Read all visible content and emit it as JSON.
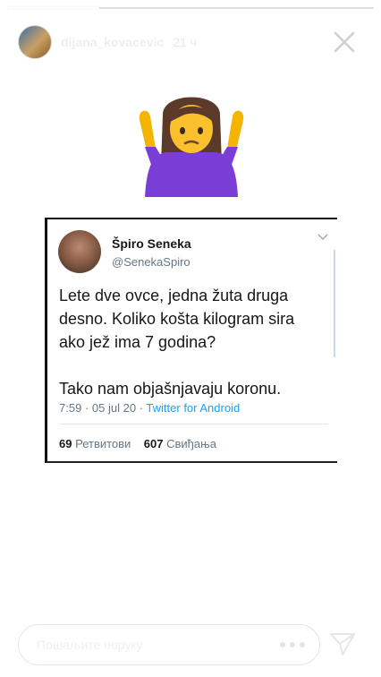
{
  "story": {
    "username": "dijana_kovacevic",
    "time": "21 ч",
    "progress": 0.25
  },
  "tweet": {
    "name": "Špiro Seneka",
    "handle": "@SenekaSpiro",
    "text": "Lete dve ovce, jedna žuta druga\ndesno. Koliko košta kilogram sira\nako jež ima 7 godina?\n\nTako nam objašnjavaju koronu.",
    "time": "7:59",
    "date": "05 jul 20",
    "separator": "·",
    "client": "Twitter for Android",
    "retweets_count": "69",
    "retweets_label": "Ретвитови",
    "likes_count": "607",
    "likes_label": "Свиђања"
  },
  "reply": {
    "placeholder": "Пошаљите поруку"
  },
  "icons": {
    "close": "close-icon",
    "more": "more-icon",
    "send": "send-icon",
    "emoji": "person-shrugging-emoji",
    "caret": "chevron-down-icon"
  }
}
